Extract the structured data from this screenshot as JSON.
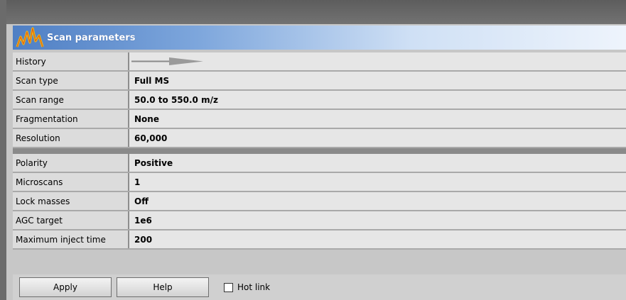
{
  "window": {
    "title": "Scan parameters",
    "icon": "spectrum-logo-icon"
  },
  "params": {
    "history": {
      "label": "History",
      "value": ""
    },
    "scan_type": {
      "label": "Scan type",
      "value": "Full MS"
    },
    "scan_range": {
      "label": "Scan range",
      "value": "50.0 to 550.0 m/z"
    },
    "fragmentation": {
      "label": "Fragmentation",
      "value": "None"
    },
    "resolution": {
      "label": "Resolution",
      "value": "60,000"
    },
    "polarity": {
      "label": "Polarity",
      "value": "Positive"
    },
    "microscans": {
      "label": "Microscans",
      "value": "1"
    },
    "lock_masses": {
      "label": "Lock masses",
      "value": "Off"
    },
    "agc_target": {
      "label": "AGC target",
      "value": "1e6"
    },
    "max_inject_time": {
      "label": "Maximum inject time",
      "value": "200"
    }
  },
  "buttons": {
    "apply": "Apply",
    "help": "Help",
    "hot_link": "Hot link",
    "hot_link_checked": false
  }
}
